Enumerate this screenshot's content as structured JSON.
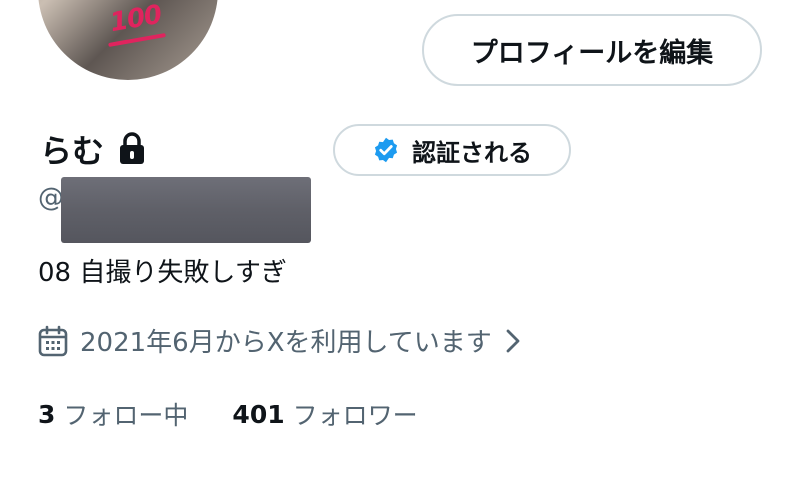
{
  "profile": {
    "display_name": "らむ",
    "handle_prefix": "@",
    "bio": "08 自撮り失敗しすぎ",
    "joined_text": "2021年6月からXを利用しています",
    "avatar_sticker": "100"
  },
  "buttons": {
    "edit_profile_label": "プロフィールを編集",
    "verify_label": "認証される"
  },
  "stats": {
    "following_count": "3",
    "following_label": "フォロー中",
    "followers_count": "401",
    "followers_label": "フォロワー"
  },
  "colors": {
    "text_primary": "#0f1419",
    "text_secondary": "#536471",
    "border": "#cfd9de",
    "verified_badge": "#1d9bf0"
  },
  "icons": {
    "lock": "lock-icon",
    "verified": "verified-badge-icon",
    "calendar": "calendar-icon",
    "chevron": "chevron-right-icon"
  }
}
